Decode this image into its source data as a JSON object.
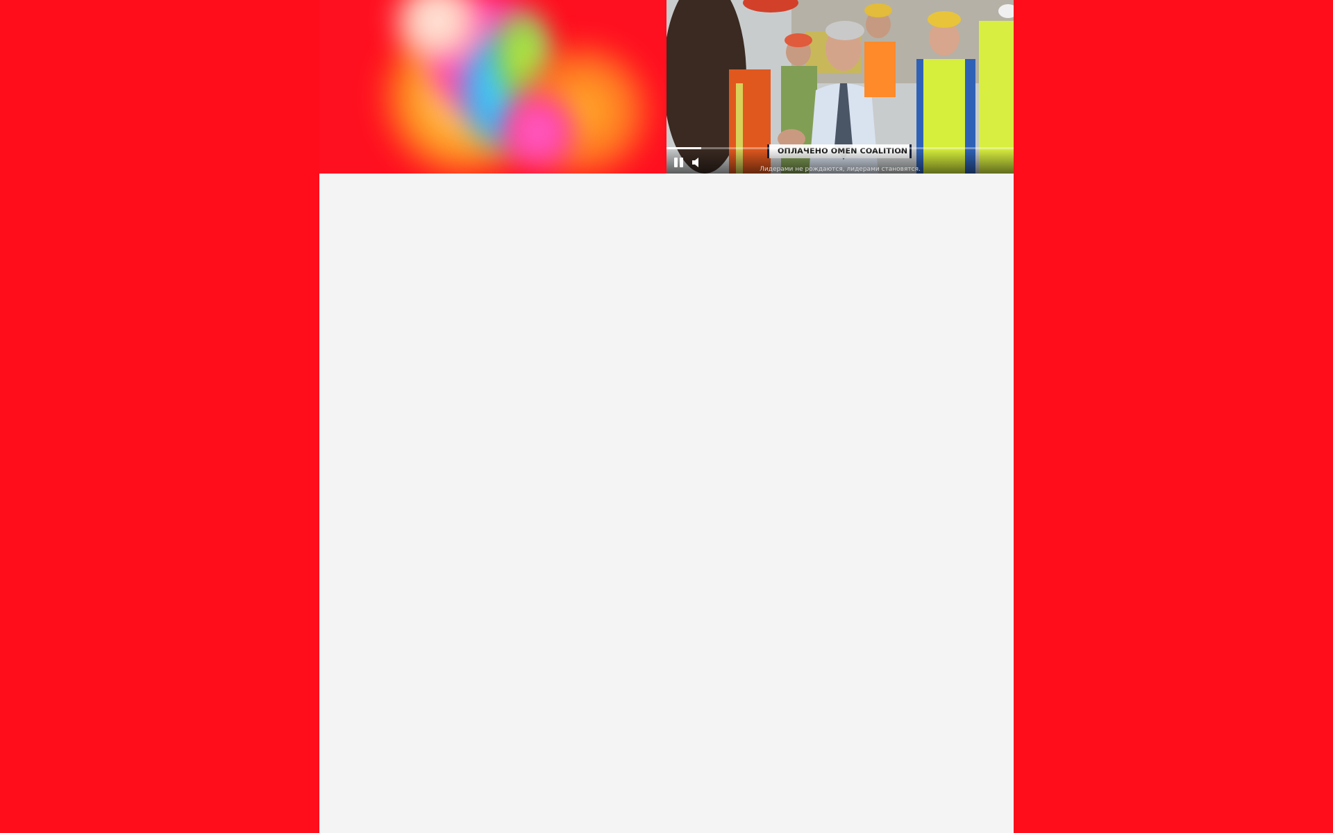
{
  "page": {
    "background_color": "#ff0d1b",
    "content_background_color": "#f4f4f4"
  },
  "banner": {
    "art": {
      "icon": "abstract-gradient-art"
    },
    "video": {
      "sponsor_label": "ОПЛАЧЕНО OMEN COALITION",
      "sponsor_chevron": "⌄",
      "caption": "Лидерами не рождаются, лидерами становятся.",
      "progress": 0.1,
      "controls": {
        "pause_icon": "pause-icon",
        "volume_icon": "volume-icon"
      }
    }
  }
}
